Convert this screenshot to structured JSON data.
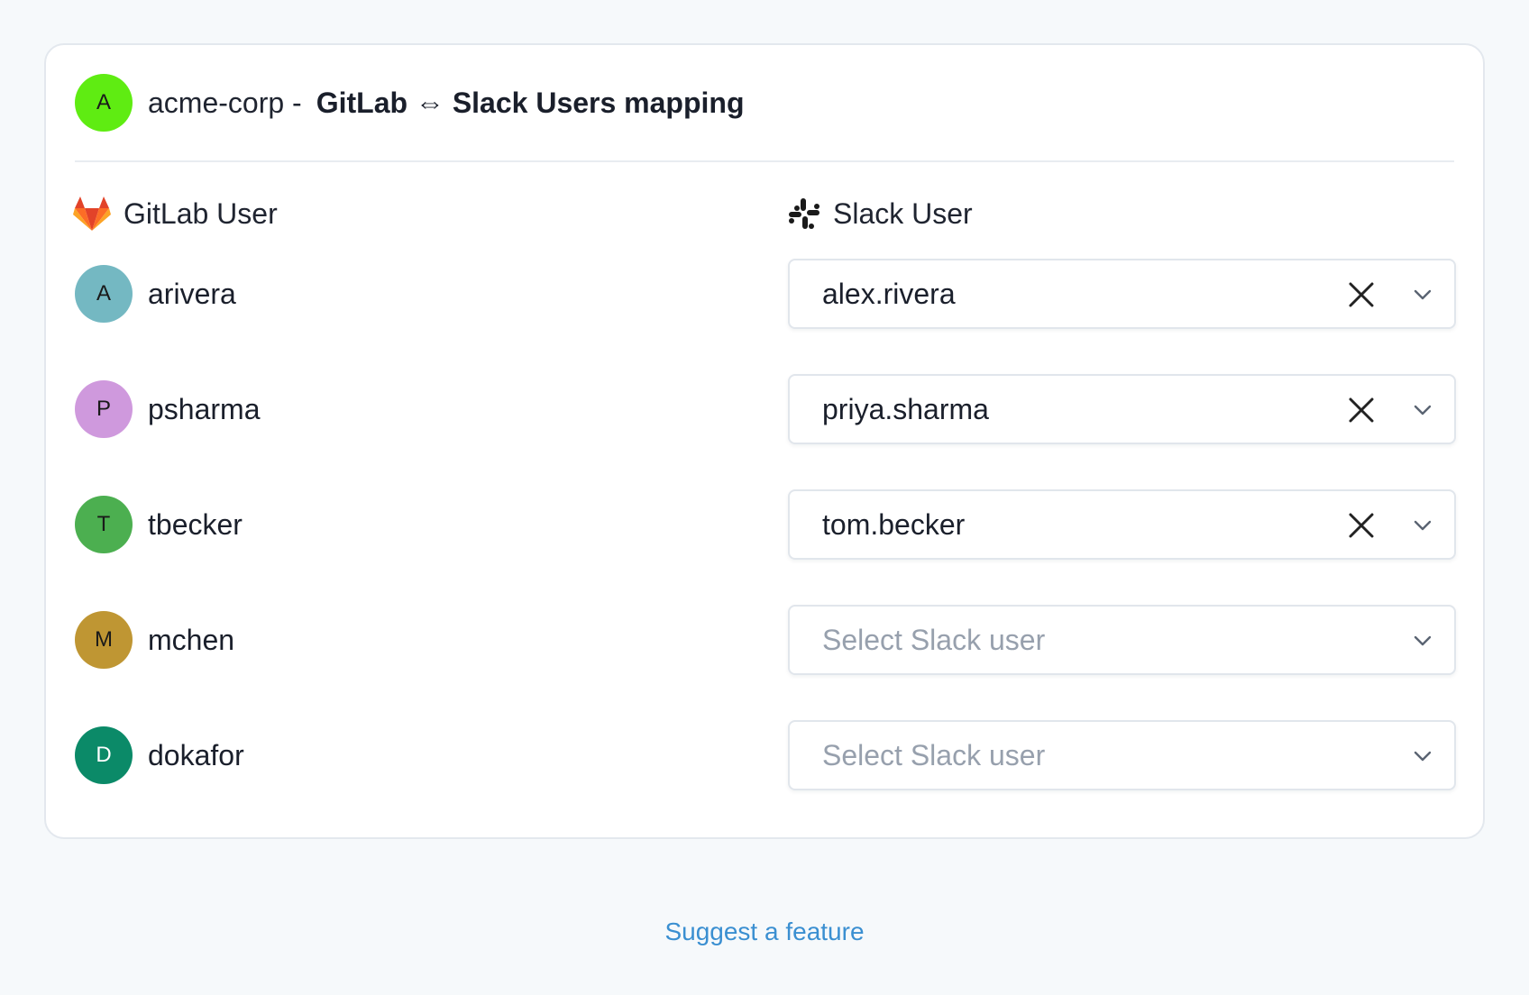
{
  "header": {
    "org_avatar_letter": "A",
    "org_name": "acme-corp -",
    "title": "GitLab ⇔ Slack Users mapping"
  },
  "columns": {
    "gitlab_label": "GitLab User",
    "slack_label": "Slack User"
  },
  "rows": [
    {
      "letter": "A",
      "gitlab_user": "arivera",
      "slack_user": "alex.rivera",
      "avatar_color": "#74b8c2"
    },
    {
      "letter": "P",
      "gitlab_user": "psharma",
      "slack_user": "priya.sharma",
      "avatar_color": "#cf99dd"
    },
    {
      "letter": "T",
      "gitlab_user": "tbecker",
      "slack_user": "tom.becker",
      "avatar_color": "#4caf50"
    },
    {
      "letter": "M",
      "gitlab_user": "mchen",
      "slack_user": "",
      "avatar_color": "#bf9633"
    },
    {
      "letter": "D",
      "gitlab_user": "dokafor",
      "slack_user": "",
      "avatar_color": "#0b8a68"
    }
  ],
  "select_placeholder": "Select Slack user",
  "footer": {
    "suggest_link": "Suggest a feature"
  },
  "colors": {
    "org_avatar": "#5fec12",
    "link": "#3a8fd1",
    "gitlab_orange": "#fc6d26",
    "gitlab_red": "#e24329",
    "gitlab_amber": "#fca326"
  },
  "icons": {
    "gitlab": "gitlab-logo-icon",
    "slack": "slack-logo-icon",
    "clear": "close-icon",
    "chevron": "chevron-down-icon"
  }
}
